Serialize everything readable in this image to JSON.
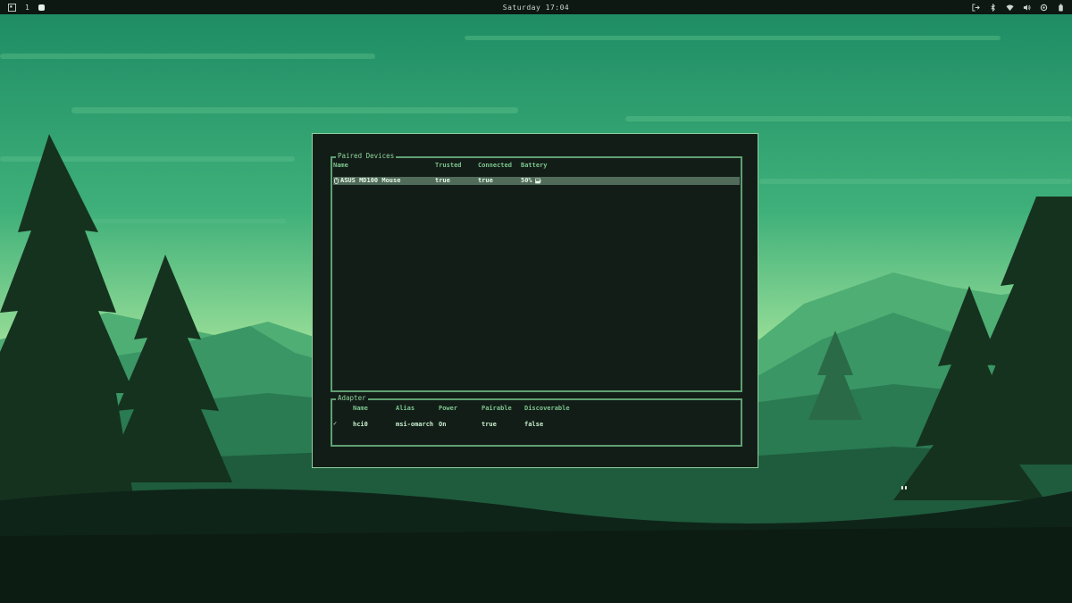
{
  "topbar": {
    "workspace": "1",
    "clock": "Saturday 17:04"
  },
  "icons": {
    "logo": "grid-logo-icon",
    "workspace_indicator": "filled-square-icon",
    "right": [
      "logout-icon",
      "bluetooth-icon",
      "wifi-icon",
      "volume-icon",
      "settings-icon",
      "battery-icon"
    ]
  },
  "paired_devices": {
    "title": "Paired Devices",
    "headers": [
      "Name",
      "Trusted",
      "Connected",
      "Battery"
    ],
    "rows": [
      {
        "name": "ASUS MD100 Mouse",
        "trusted": "true",
        "connected": "true",
        "battery": "50%",
        "battery_level": 0.5,
        "selected": true
      }
    ]
  },
  "adapter": {
    "title": "Adapter",
    "headers": [
      "Name",
      "Alias",
      "Power",
      "Pairable",
      "Discoverable"
    ],
    "rows": [
      {
        "active_mark": "✓",
        "name": "hci0",
        "alias": "msi-omarch",
        "power": "On",
        "pairable": "true",
        "discoverable": "false"
      }
    ]
  },
  "colors": {
    "accent": "#8fd79c",
    "border": "#5fa072",
    "window_bg": "#131d18",
    "selection": "#516b5a",
    "sky_top": "#1d8a63",
    "sky_bottom": "#9fe29a"
  }
}
